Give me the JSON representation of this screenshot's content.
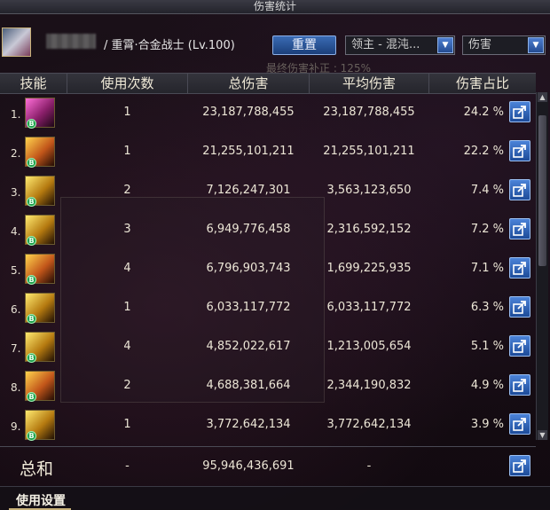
{
  "window": {
    "title": "伤害统计"
  },
  "header": {
    "player_info": "/ 重霄·合金战士 (Lv.100)",
    "reset_button": "重置",
    "boss_dropdown": "领主 - 混沌...",
    "type_dropdown": "伤害",
    "faint_note": "最终伤害补正 : 125%"
  },
  "table": {
    "columns": [
      "技能",
      "使用次数",
      "总伤害",
      "平均伤害",
      "伤害占比"
    ],
    "rows": [
      {
        "rank": "1.",
        "count": "1",
        "total": "23,187,788,455",
        "avg": "23,187,788,455",
        "pct": "24.2 %",
        "icon": "skill-icon-1"
      },
      {
        "rank": "2.",
        "count": "1",
        "total": "21,255,101,211",
        "avg": "21,255,101,211",
        "pct": "22.2 %",
        "icon": "skill-icon-2"
      },
      {
        "rank": "3.",
        "count": "2",
        "total": "7,126,247,301",
        "avg": "3,563,123,650",
        "pct": "7.4 %",
        "icon": "skill-icon-3"
      },
      {
        "rank": "4.",
        "count": "3",
        "total": "6,949,776,458",
        "avg": "2,316,592,152",
        "pct": "7.2 %",
        "icon": "skill-icon-4"
      },
      {
        "rank": "5.",
        "count": "4",
        "total": "6,796,903,743",
        "avg": "1,699,225,935",
        "pct": "7.1 %",
        "icon": "skill-icon-5"
      },
      {
        "rank": "6.",
        "count": "1",
        "total": "6,033,117,772",
        "avg": "6,033,117,772",
        "pct": "6.3 %",
        "icon": "skill-icon-6"
      },
      {
        "rank": "7.",
        "count": "4",
        "total": "4,852,022,617",
        "avg": "1,213,005,654",
        "pct": "5.1 %",
        "icon": "skill-icon-7"
      },
      {
        "rank": "8.",
        "count": "2",
        "total": "4,688,381,664",
        "avg": "2,344,190,832",
        "pct": "4.9 %",
        "icon": "skill-icon-8"
      },
      {
        "rank": "9.",
        "count": "1",
        "total": "3,772,642,134",
        "avg": "3,772,642,134",
        "pct": "3.9 %",
        "icon": "skill-icon-9"
      }
    ]
  },
  "total": {
    "label": "总和",
    "count": "-",
    "total": "95,946,436,691",
    "avg": "-"
  },
  "settings": {
    "label": "使用设置"
  },
  "colors": {
    "accent_blue": "#2f63b0",
    "gold_border": "#c9b27a",
    "green_badge": "#1e9e4a"
  }
}
